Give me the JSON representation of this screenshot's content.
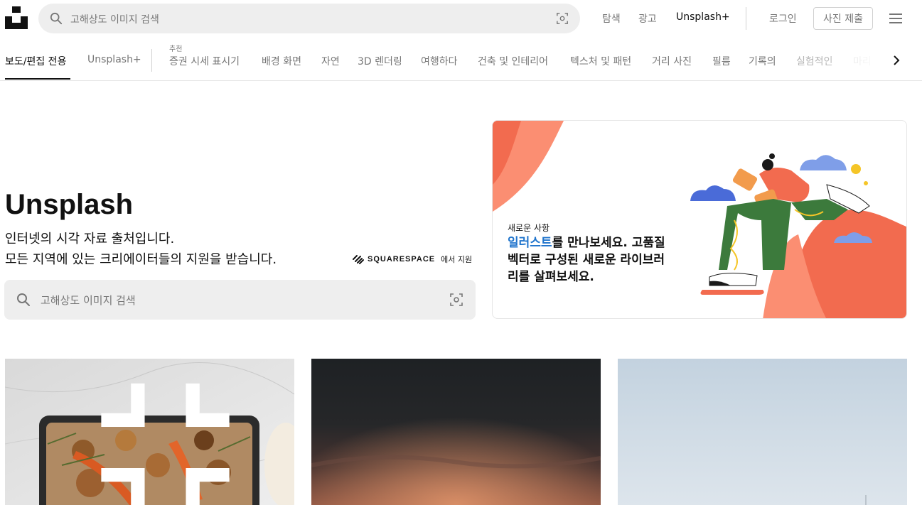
{
  "header": {
    "search_placeholder": "고해상도 이미지 검색",
    "links": {
      "explore": "탐색",
      "advertise": "광고",
      "plus": "Unsplash+",
      "login": "로그인"
    },
    "submit_label": "사진 제출"
  },
  "topics": {
    "primary": [
      "보도/편집 전용",
      "Unsplash+"
    ],
    "recommended_label": "추천",
    "items": [
      "증권 시세 표시기",
      "배경 화면",
      "자연",
      "3D 렌더링",
      "여행하다",
      "건축 및 인테리어",
      "텍스처 및 패턴",
      "거리 사진",
      "필름",
      "기록의",
      "실험적인",
      "마리"
    ]
  },
  "hero": {
    "title": "Unsplash",
    "subtitle_line1": "인터넷의 시각 자료 출처입니다.",
    "subtitle_line2": "모든 지역에 있는 크리에이터들의 지원을 받습니다.",
    "sponsor_name": "SQUARESPACE",
    "sponsor_suffix": "에서 지원",
    "search_placeholder": "고해상도 이미지 검색"
  },
  "promo": {
    "kicker": "새로운 사항",
    "headline_accent": "일러스트",
    "headline_rest": "를 만나보세요. 고품질 벡터로 구성된 새로운 라이브러리를 살펴보세요."
  },
  "photos": [
    {
      "subject": "roasted-vegetables-tray",
      "watermark": "Unsplash+"
    },
    {
      "subject": "dark-sunset-clouds"
    },
    {
      "subject": "pale-blue-sky"
    }
  ],
  "colors": {
    "accent": "#1f74cc",
    "text_primary": "#111111",
    "text_secondary": "#767676",
    "search_bg": "#eeeeee",
    "promo_coral": "#f26b4f"
  }
}
